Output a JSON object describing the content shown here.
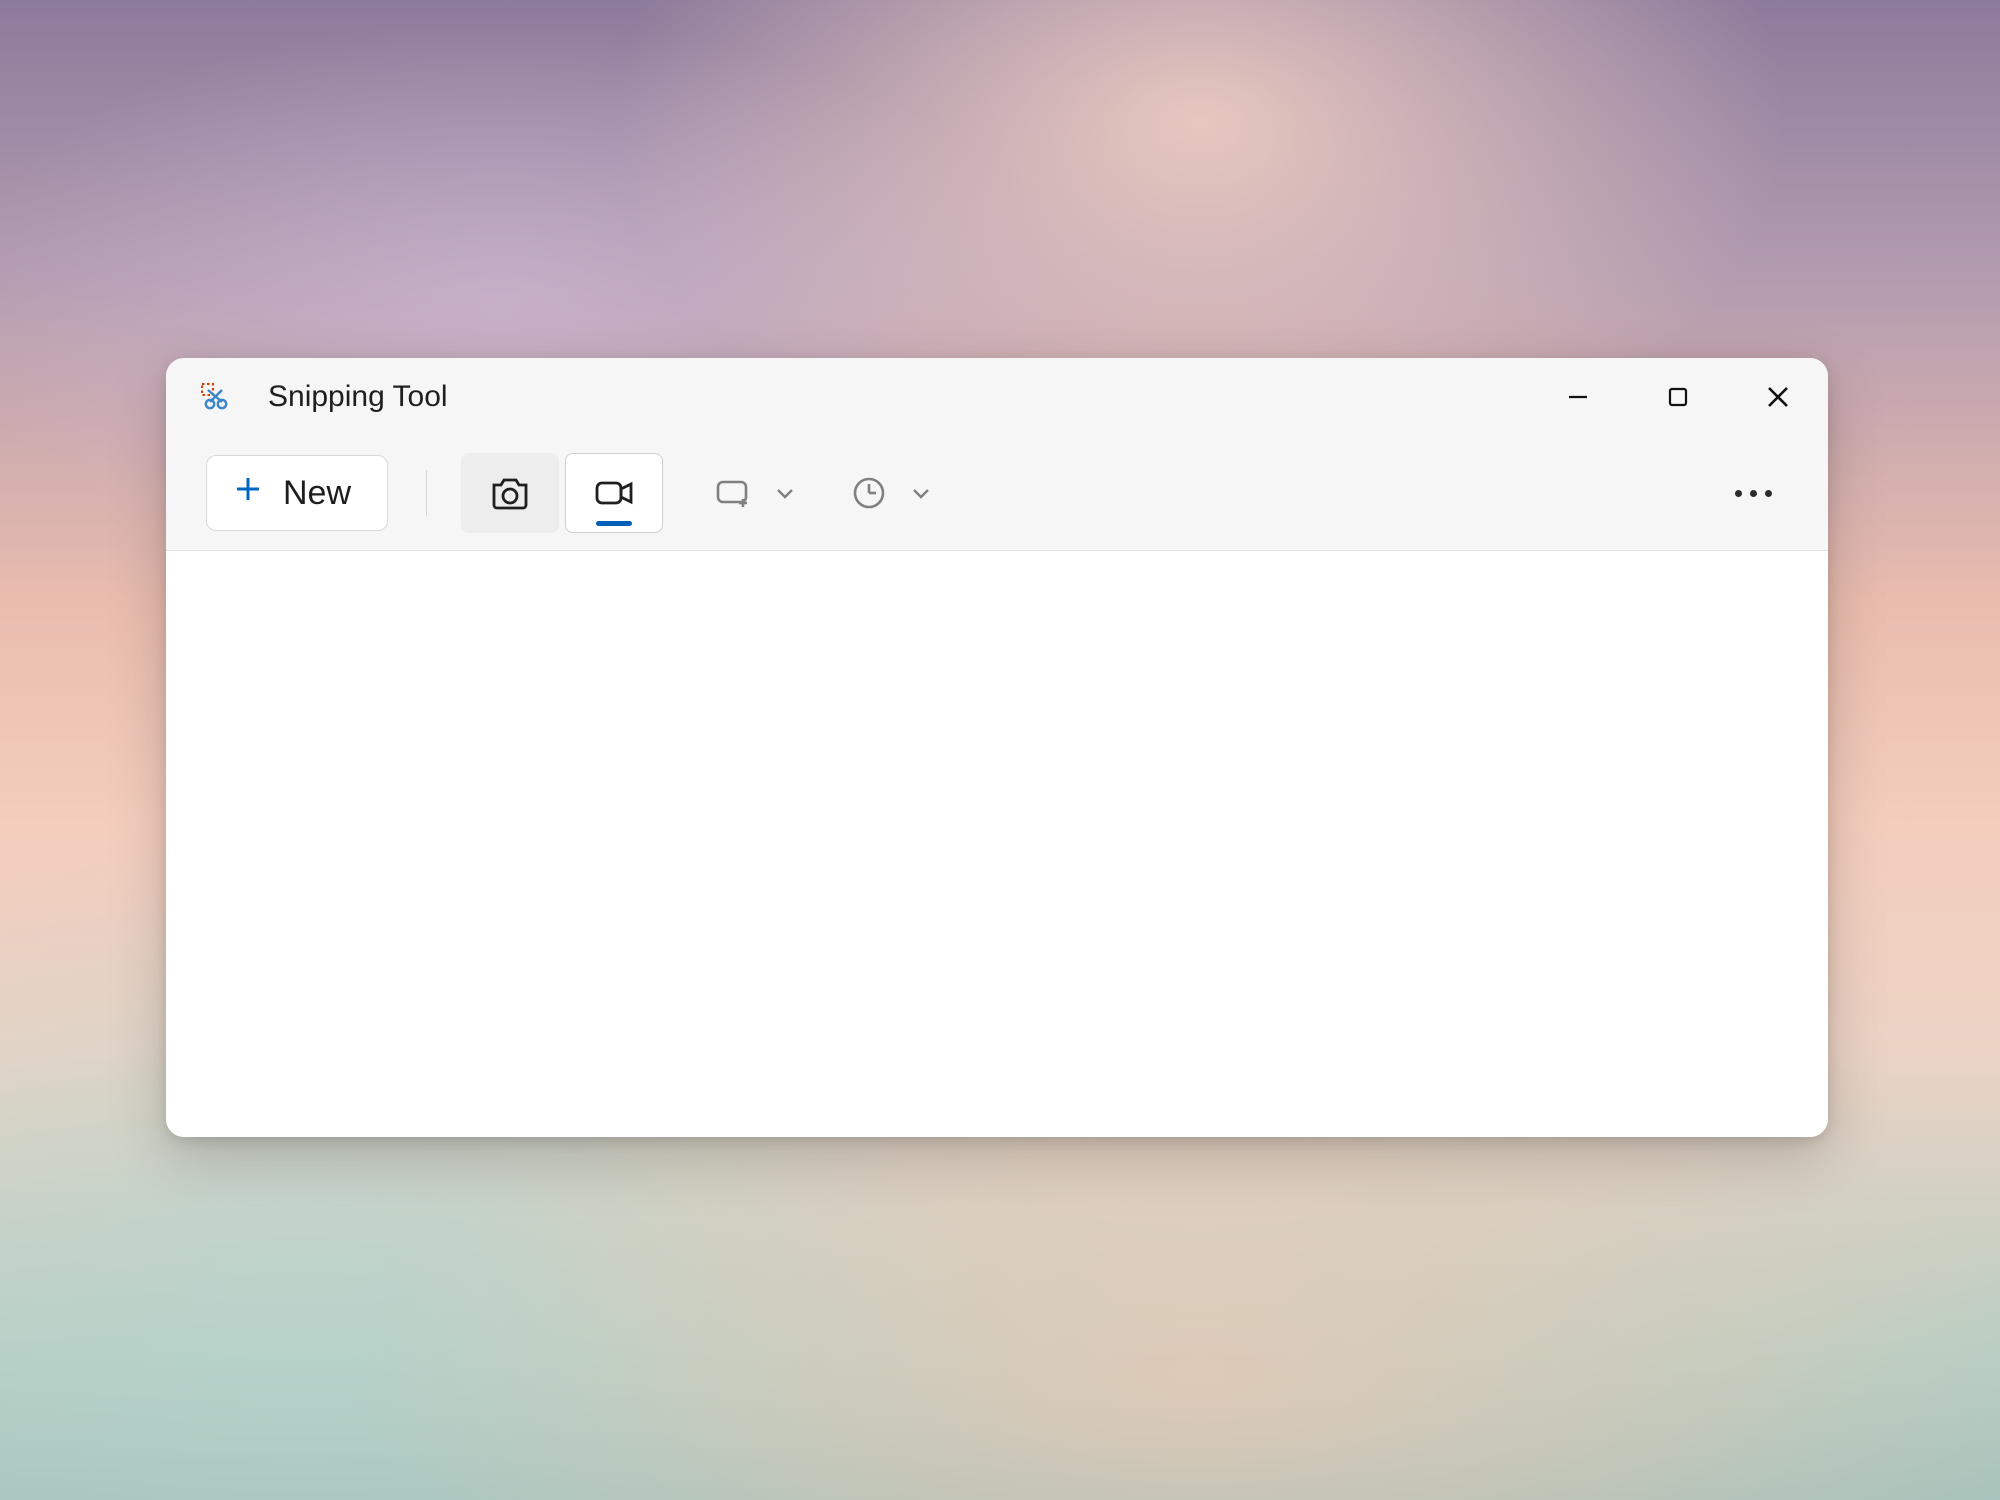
{
  "app": {
    "title": "Snipping Tool"
  },
  "toolbar": {
    "new_label": "New"
  },
  "colors": {
    "accent": "#005fb8"
  }
}
